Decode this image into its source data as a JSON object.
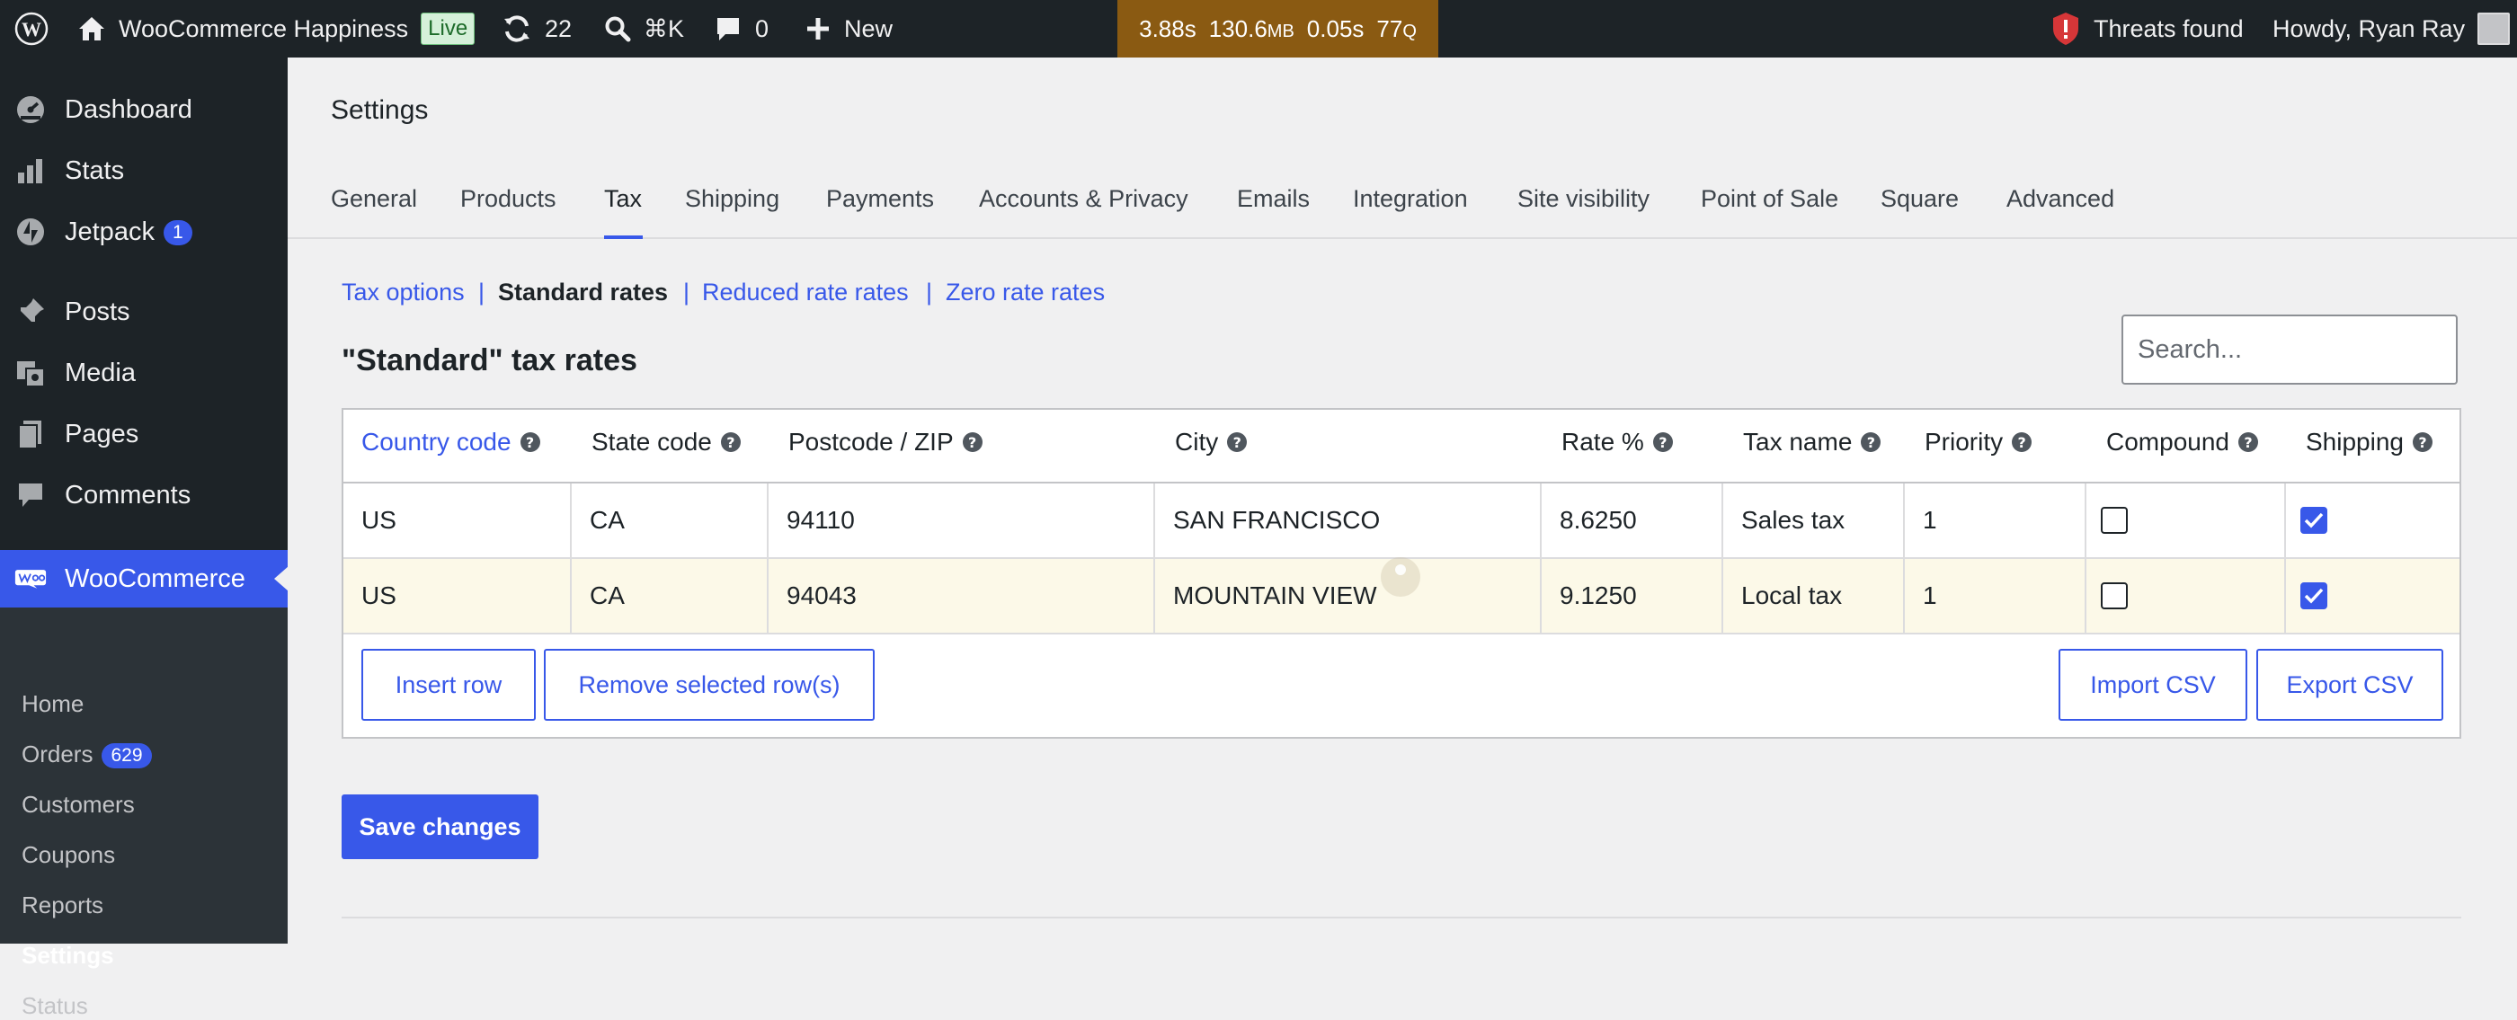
{
  "adminbar": {
    "site_name": "WooCommerce Happiness",
    "live_badge": "Live",
    "updates_count": "22",
    "search_shortcut": "⌘K",
    "comments_count": "0",
    "new_label": "New",
    "perf": {
      "time": "3.88s",
      "memory": "130.6",
      "memory_unit": "MB",
      "query_time": "0.05s",
      "queries": "77",
      "queries_unit": "Q"
    },
    "threats": "Threats found",
    "howdy": "Howdy, Ryan Ray"
  },
  "sidebar": {
    "items": [
      {
        "label": "Dashboard",
        "icon": "dashboard-icon"
      },
      {
        "label": "Stats",
        "icon": "stats-icon"
      },
      {
        "label": "Jetpack",
        "icon": "jetpack-icon",
        "badge": "1"
      },
      {
        "label": "Posts",
        "icon": "pin-icon"
      },
      {
        "label": "Media",
        "icon": "media-icon"
      },
      {
        "label": "Pages",
        "icon": "pages-icon"
      },
      {
        "label": "Comments",
        "icon": "comments-icon"
      },
      {
        "label": "WooCommerce",
        "icon": "woocommerce-icon"
      }
    ],
    "submenu": [
      {
        "label": "Home"
      },
      {
        "label": "Orders",
        "badge": "629"
      },
      {
        "label": "Customers"
      },
      {
        "label": "Coupons"
      },
      {
        "label": "Reports"
      },
      {
        "label": "Settings"
      },
      {
        "label": "Status"
      }
    ]
  },
  "main": {
    "title": "Settings",
    "tabs": [
      {
        "label": "General"
      },
      {
        "label": "Products"
      },
      {
        "label": "Tax"
      },
      {
        "label": "Shipping"
      },
      {
        "label": "Payments"
      },
      {
        "label": "Accounts & Privacy"
      },
      {
        "label": "Emails"
      },
      {
        "label": "Integration"
      },
      {
        "label": "Site visibility"
      },
      {
        "label": "Point of Sale"
      },
      {
        "label": "Square"
      },
      {
        "label": "Advanced"
      }
    ],
    "active_tab": "Tax",
    "subsubsub": [
      {
        "label": "Tax options"
      },
      {
        "label": "Standard rates"
      },
      {
        "label": "Reduced rate rates"
      },
      {
        "label": "Zero rate rates"
      }
    ],
    "separator": "|",
    "rates_title": "\"Standard\" tax rates",
    "search_placeholder": "Search...",
    "table": {
      "headers": [
        "Country code",
        "State code",
        "Postcode / ZIP",
        "City",
        "Rate %",
        "Tax name",
        "Priority",
        "Compound",
        "Shipping"
      ],
      "help_glyph": "?",
      "rows": [
        {
          "country": "US",
          "state": "CA",
          "postcode": "94110",
          "city": "SAN FRANCISCO",
          "rate": "8.6250",
          "name": "Sales tax",
          "priority": "1",
          "compound": false,
          "shipping": true
        },
        {
          "country": "US",
          "state": "CA",
          "postcode": "94043",
          "city": "MOUNTAIN VIEW",
          "rate": "9.1250",
          "name": "Local tax",
          "priority": "1",
          "compound": false,
          "shipping": true
        }
      ]
    },
    "buttons": {
      "insert_row": "Insert row",
      "remove_rows": "Remove selected row(s)",
      "import_csv": "Import CSV",
      "export_csv": "Export CSV",
      "save": "Save changes"
    }
  },
  "colors": {
    "accent": "#3858e9",
    "adminbar": "#1d2327",
    "selected_row": "#fcf9e8",
    "perf_bar": "#8a5a12",
    "threat": "#d63638"
  }
}
